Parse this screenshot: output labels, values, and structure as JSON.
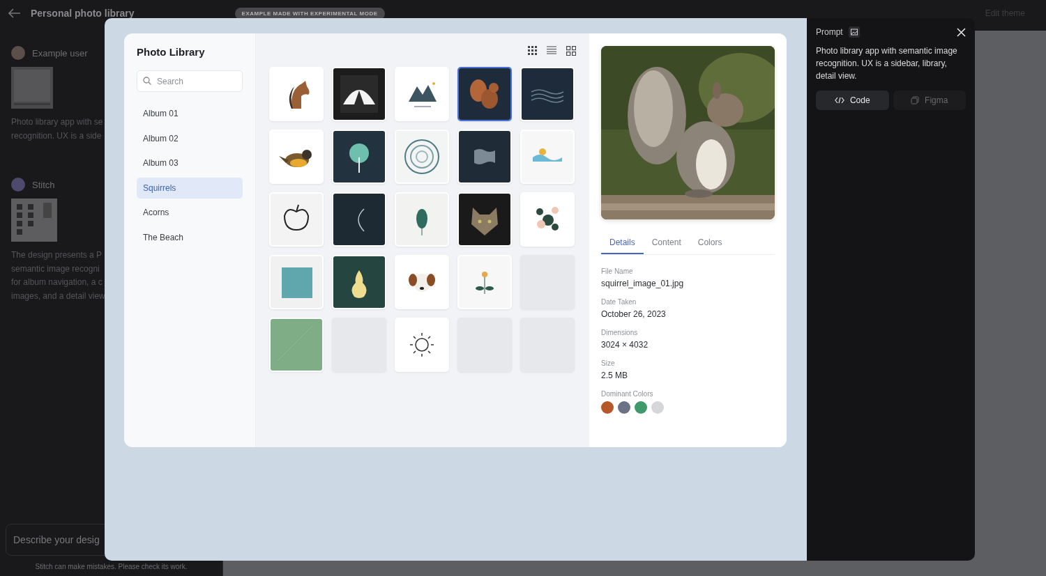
{
  "app_bar": {
    "title": "Personal photo library",
    "badge": "EXAMPLE MADE WITH EXPERIMENTAL MODE",
    "edit_theme": "Edit theme"
  },
  "chat": {
    "messages": [
      {
        "author": "Example user",
        "lines": [
          "Photo library app with se",
          "recognition. UX is a side"
        ]
      },
      {
        "author": "Stitch",
        "lines": [
          "The design presents a P",
          "semantic image recogni",
          "for album navigation, a c",
          "images, and a detail view"
        ]
      }
    ],
    "input": {
      "placeholder": "Describe your desig"
    },
    "disclaimer": "Stitch can make mistakes. Please check its work."
  },
  "preview": {
    "sidebar": {
      "title": "Photo Library",
      "search": {
        "placeholder": "Search"
      },
      "albums": [
        {
          "label": "Album 01",
          "selected": false
        },
        {
          "label": "Album 02",
          "selected": false
        },
        {
          "label": "Album 03",
          "selected": false
        },
        {
          "label": "Squirrels",
          "selected": true
        },
        {
          "label": "Acorns",
          "selected": false
        },
        {
          "label": "The Beach",
          "selected": false
        }
      ]
    },
    "view_modes": [
      {
        "kind": "dots"
      },
      {
        "kind": "list"
      },
      {
        "kind": "grid"
      }
    ],
    "tiles": [
      {
        "kind": "picture",
        "selected": false
      },
      {
        "kind": "picture",
        "selected": false
      },
      {
        "kind": "picture",
        "selected": false
      },
      {
        "kind": "picture",
        "selected": true
      },
      {
        "kind": "picture",
        "selected": false
      },
      {
        "kind": "picture",
        "selected": false
      },
      {
        "kind": "picture",
        "selected": false
      },
      {
        "kind": "picture",
        "selected": false
      },
      {
        "kind": "picture",
        "selected": false
      },
      {
        "kind": "picture",
        "selected": false
      },
      {
        "kind": "picture",
        "selected": false
      },
      {
        "kind": "picture",
        "selected": false
      },
      {
        "kind": "picture",
        "selected": false
      },
      {
        "kind": "picture",
        "selected": false
      },
      {
        "kind": "picture",
        "selected": false
      },
      {
        "kind": "picture",
        "selected": false
      },
      {
        "kind": "picture",
        "selected": false
      },
      {
        "kind": "picture",
        "selected": false
      },
      {
        "kind": "picture",
        "selected": false
      },
      {
        "kind": "placeholder",
        "selected": false
      },
      {
        "kind": "picture",
        "selected": false
      },
      {
        "kind": "placeholder",
        "selected": false
      },
      {
        "kind": "picture",
        "selected": false
      },
      {
        "kind": "placeholder",
        "selected": false
      },
      {
        "kind": "placeholder",
        "selected": false
      }
    ],
    "detail": {
      "tabs": [
        {
          "label": "Details",
          "selected": true
        },
        {
          "label": "Content",
          "selected": false
        },
        {
          "label": "Colors",
          "selected": false
        }
      ],
      "fields": [
        {
          "label": "File Name",
          "value": "squirrel_image_01.jpg"
        },
        {
          "label": "Date Taken",
          "value": "October 26, 2023"
        },
        {
          "label": "Dimensions",
          "value": "3024 × 4032"
        },
        {
          "label": "Size",
          "value": "2.5 MB"
        }
      ],
      "colors_label": "Dominant Colors",
      "colors": [
        {
          "color": "#b5582a"
        },
        {
          "color": "#6b7285"
        },
        {
          "color": "#3e9a6b"
        },
        {
          "color": "#d5d7da"
        }
      ]
    }
  },
  "prompt_panel": {
    "title": "Prompt",
    "text": "Photo library app with semantic image recognition. UX is a sidebar, library, detail view.",
    "buttons": [
      {
        "label": "Code",
        "kind": "primary"
      },
      {
        "label": "Figma",
        "kind": "secondary"
      }
    ]
  }
}
